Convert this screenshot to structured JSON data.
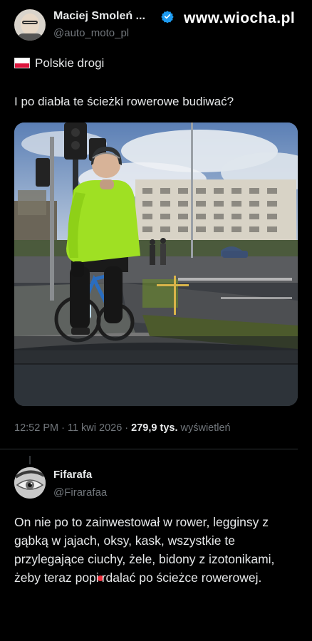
{
  "post": {
    "author_name": "Maciej Smoleń ...",
    "author_handle": "@auto_moto_pl",
    "watermark": "www.wiocha.pl",
    "flag_label": "Polskie drogi",
    "text": "I po diabła te ścieżki rowerowe budiwać?",
    "time": "12:52 PM",
    "sep1": " · ",
    "date": "11 kwi 2026",
    "sep2": " · ",
    "views_count": "279,9 tys.",
    "views_label": " wyświetleń",
    "colors": {
      "background": "#000000",
      "text": "#e7e9ea",
      "muted": "#71767b",
      "verified": "#1d9bf0",
      "jacket": "#9fe023"
    },
    "icons": [
      "verified-badge-icon",
      "poland-flag-icon"
    ]
  },
  "reply": {
    "author_name": "Fifarafa",
    "author_handle": "@Firarafaa",
    "text_before": "On nie po to zainwestował w rower, legginsy z gąbką w jajach, oksy, kask, wszystkie te przylegające ciuchy, żele, bidony z izotonikami, żeby teraz popi",
    "text_after": "rdalać po ścieżce rowerowej."
  }
}
